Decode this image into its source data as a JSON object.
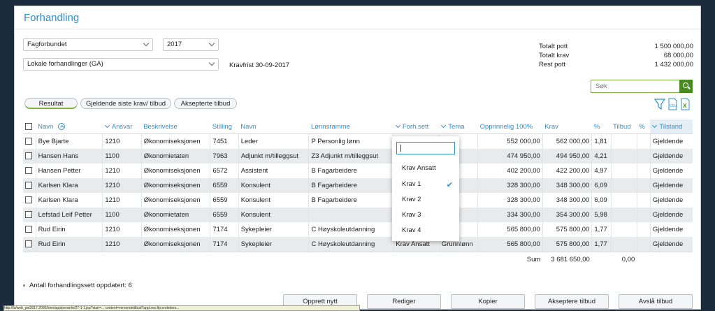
{
  "page": {
    "title": "Forhandling"
  },
  "filters": {
    "organization": "Fagforbundet",
    "year": "2017",
    "negotiation": "Lokale forhandlinger (GA)",
    "kravfrist": "Kravfrist 30-09-2017"
  },
  "totals": [
    {
      "label": "Totalt pott",
      "value": "1 500 000,00"
    },
    {
      "label": "Totalt krav",
      "value": "68 000,00"
    },
    {
      "label": "Rest pott",
      "value": "1 432 000,00"
    }
  ],
  "search": {
    "placeholder": "Søk"
  },
  "tabs": [
    {
      "label": "Resultat"
    },
    {
      "label": "Gjeldende siste krav/ tilbud"
    },
    {
      "label": "Aksepterte tilbud"
    }
  ],
  "table": {
    "headers": {
      "navn": "Navn",
      "ansvar": "Ansvar",
      "beskrivelse": "Beskrivelse",
      "stilling": "Stilling",
      "navn2": "Navn",
      "lonnsramme": "Lønnsramme",
      "forhsett": "Forh.sett",
      "tema": "Tema",
      "opprinnelig": "Opprinnelig 100%",
      "krav": "Krav",
      "pct": "%",
      "tilbud": "Tilbud",
      "pct2": "%",
      "tilstand": "Tilstand"
    },
    "rows": [
      {
        "navn": "Bye Bjarte",
        "ansvar": "1210",
        "beskrivelse": "Økonomiseksjonen",
        "stilling": "7451",
        "navn2": "Leder",
        "lonnsramme": "P Personlig lønn",
        "forhsett": "",
        "tema": "ønn",
        "opprinnelig": "552 000,00",
        "krav": "562 000,00",
        "pct": "1,81",
        "tilbud": "",
        "pct2": "",
        "tilstand": "Gjeldende"
      },
      {
        "navn": "Hansen Hans",
        "ansvar": "1100",
        "beskrivelse": "Økonomietaten",
        "stilling": "7963",
        "navn2": "Adjunkt m/tilleggsut",
        "lonnsramme": "Z3 Adjunkt m/tilleggsut",
        "forhsett": "",
        "tema": "ønn",
        "opprinnelig": "474 950,00",
        "krav": "494 950,00",
        "pct": "4,21",
        "tilbud": "",
        "pct2": "",
        "tilstand": "Gjeldende"
      },
      {
        "navn": "Hansen Petter",
        "ansvar": "1210",
        "beskrivelse": "Økonomiseksjonen",
        "stilling": "6572",
        "navn2": "Assistent",
        "lonnsramme": "B Fagarbeidere",
        "forhsett": "",
        "tema": "ønn",
        "opprinnelig": "402 200,00",
        "krav": "422 200,00",
        "pct": "4,97",
        "tilbud": "",
        "pct2": "",
        "tilstand": "Gjeldende"
      },
      {
        "navn": "Karlsen Klara",
        "ansvar": "1210",
        "beskrivelse": "Økonomiseksjonen",
        "stilling": "6559",
        "navn2": "Konsulent",
        "lonnsramme": "B Fagarbeidere",
        "forhsett": "",
        "tema": "ønn",
        "opprinnelig": "328 300,00",
        "krav": "348 300,00",
        "pct": "6,09",
        "tilbud": "",
        "pct2": "",
        "tilstand": "Gjeldende"
      },
      {
        "navn": "Karlsen Klara",
        "ansvar": "1210",
        "beskrivelse": "Økonomiseksjonen",
        "stilling": "6559",
        "navn2": "Konsulent",
        "lonnsramme": "B Fagarbeidere",
        "forhsett": "",
        "tema": "ønn",
        "opprinnelig": "328 300,00",
        "krav": "348 300,00",
        "pct": "6,09",
        "tilbud": "",
        "pct2": "",
        "tilstand": "Gjeldende"
      },
      {
        "navn": "Lefstad Leif Petter",
        "ansvar": "1100",
        "beskrivelse": "Økonomietaten",
        "stilling": "6559",
        "navn2": "Konsulent",
        "lonnsramme": "",
        "forhsett": "",
        "tema": "ønn",
        "opprinnelig": "334 300,00",
        "krav": "354 300,00",
        "pct": "5,98",
        "tilbud": "",
        "pct2": "",
        "tilstand": "Gjeldende"
      },
      {
        "navn": "Rud Eirin",
        "ansvar": "1210",
        "beskrivelse": "Økonomiseksjonen",
        "stilling": "7174",
        "navn2": "Sykepleier",
        "lonnsramme": "C Høyskoleutdanning",
        "forhsett": "",
        "tema": "ønn",
        "opprinnelig": "565 800,00",
        "krav": "575 800,00",
        "pct": "1,77",
        "tilbud": "",
        "pct2": "",
        "tilstand": "Gjeldende"
      },
      {
        "navn": "Rud Eirin",
        "ansvar": "1210",
        "beskrivelse": "Økonomiseksjonen",
        "stilling": "7174",
        "navn2": "Sykepleier",
        "lonnsramme": "C Høyskoleutdanning",
        "forhsett": "Krav Ansatt",
        "tema": "Grunnlønn",
        "opprinnelig": "565 800,00",
        "krav": "575 800,00",
        "pct": "1,77",
        "tilbud": "",
        "pct2": "",
        "tilstand": "Gjeldende"
      }
    ],
    "sum": {
      "label": "Sum",
      "krav": "3 681 650,00",
      "tilbud": "0,00"
    }
  },
  "filter_dropdown": {
    "options": [
      "Krav Ansatt",
      "Krav 1",
      "Krav 2",
      "Krav 3",
      "Krav 4"
    ],
    "selected": "Krav 1"
  },
  "status": {
    "text": "Antall forhandlingssett oppdatert: 6"
  },
  "actions": [
    {
      "label": "Opprett nytt"
    },
    {
      "label": "Rediger"
    },
    {
      "label": "Kopier"
    },
    {
      "label": "Akseptere tilbud"
    },
    {
      "label": "Avslå tilbud"
    }
  ],
  "colors": {
    "accent": "#2f8fcb",
    "green": "#4a8a23",
    "row_alt": "#e9eaeb"
  },
  "icons": [
    "filter-icon",
    "csv-export-icon",
    "excel-export-icon",
    "search-icon",
    "check-icon"
  ],
  "statusbar": {
    "url": "http://lu/web_pnt2017.2000/lonn/app/persinfo/27-1-1.jsp?start=... content=versendetilbud?appl.res.ftp.endetters..."
  }
}
